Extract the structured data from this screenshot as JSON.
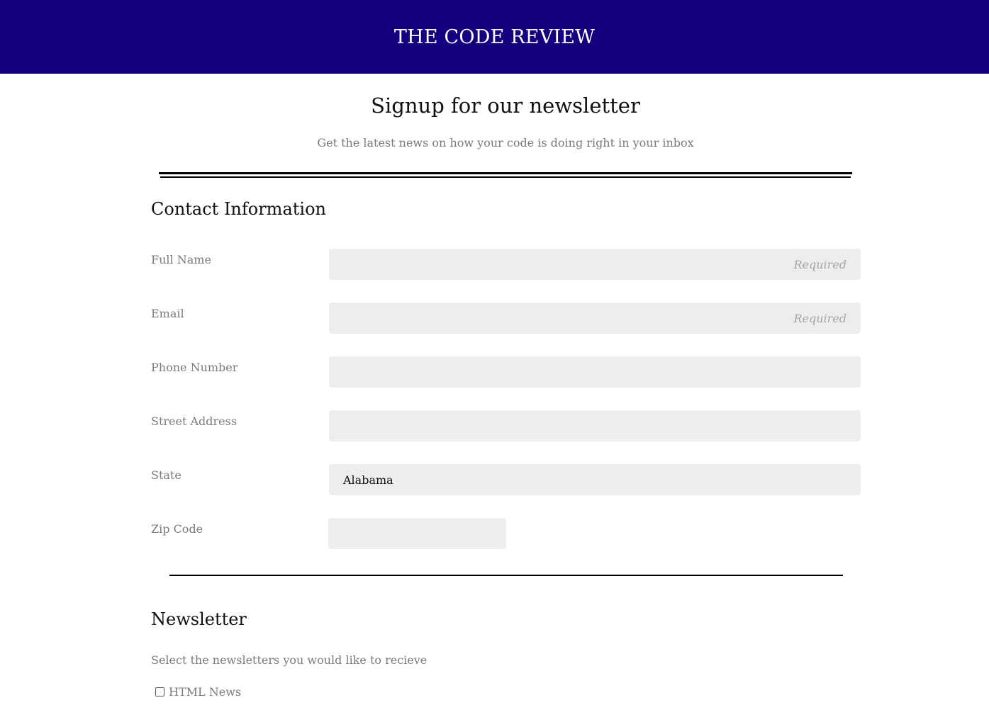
{
  "header": {
    "site_title": "THE CODE REVIEW",
    "background_color": "#150080"
  },
  "intro": {
    "title": "Signup for our newsletter",
    "subtitle": "Get the latest news on how your code is doing right in your inbox"
  },
  "contact": {
    "section_title": "Contact Information",
    "fields": [
      {
        "label": "Full Name",
        "placeholder": "Required",
        "value": ""
      },
      {
        "label": "Email",
        "placeholder": "Required",
        "value": ""
      },
      {
        "label": "Phone Number",
        "placeholder": "",
        "value": ""
      },
      {
        "label": "Street Address",
        "placeholder": "",
        "value": ""
      },
      {
        "label": "State",
        "value": "Alabama"
      },
      {
        "label": "Zip Code",
        "value": ""
      }
    ]
  },
  "newsletter": {
    "section_title": "Newsletter",
    "description": "Select the newsletters you would like to recieve",
    "options": [
      {
        "label": "HTML News",
        "checked": false
      }
    ]
  }
}
